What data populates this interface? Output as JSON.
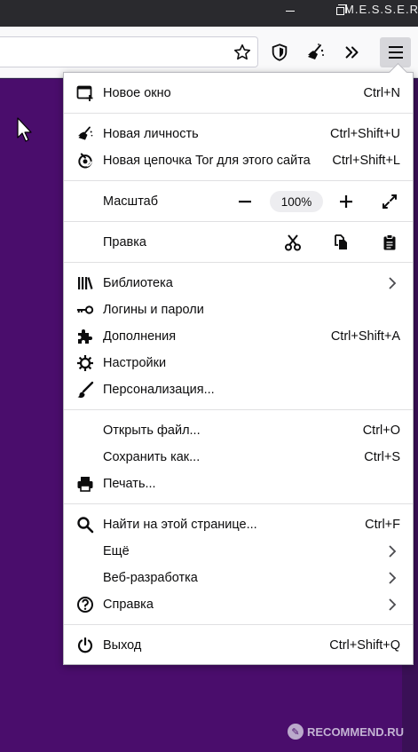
{
  "window": {
    "title": "M.E.S.S.E.R."
  },
  "toolbar": {
    "icons": [
      "bookmark-star-icon",
      "shield-icon",
      "magic-broom-icon",
      "overflow-chevrons-icon",
      "hamburger-menu-icon"
    ]
  },
  "menu": {
    "new_window": {
      "label": "Новое окно",
      "shortcut": "Ctrl+N"
    },
    "new_identity": {
      "label": "Новая личность",
      "shortcut": "Ctrl+Shift+U"
    },
    "new_circuit": {
      "label": "Новая цепочка Tor для этого сайта",
      "shortcut": "Ctrl+Shift+L"
    },
    "zoom": {
      "label": "Масштаб",
      "value": "100%"
    },
    "edit": {
      "label": "Правка"
    },
    "library": {
      "label": "Библиотека"
    },
    "logins": {
      "label": "Логины и пароли"
    },
    "addons": {
      "label": "Дополнения",
      "shortcut": "Ctrl+Shift+A"
    },
    "settings": {
      "label": "Настройки"
    },
    "customize": {
      "label": "Персонализация..."
    },
    "open_file": {
      "label": "Открыть файл...",
      "shortcut": "Ctrl+O"
    },
    "save_as": {
      "label": "Сохранить как...",
      "shortcut": "Ctrl+S"
    },
    "print": {
      "label": "Печать..."
    },
    "find": {
      "label": "Найти на этой странице...",
      "shortcut": "Ctrl+F"
    },
    "more": {
      "label": "Ещё"
    },
    "web_dev": {
      "label": "Веб-разработка"
    },
    "help": {
      "label": "Справка"
    },
    "quit": {
      "label": "Выход",
      "shortcut": "Ctrl+Shift+Q"
    }
  },
  "watermark": {
    "text": "RECOMMEND.RU"
  },
  "colors": {
    "page_background": "#4a0d6c",
    "menu_background": "#ffffff",
    "menu_button_active": "#d7d7db"
  }
}
